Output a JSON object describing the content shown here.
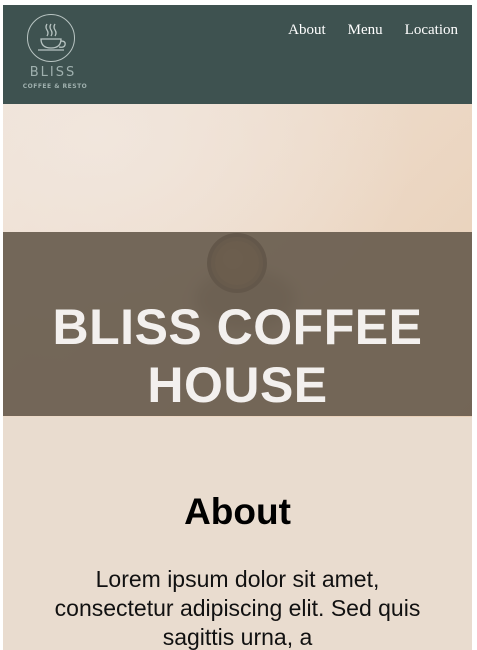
{
  "header": {
    "logo": {
      "name": "BLISS",
      "tagline": "COFFEE & RESTO"
    },
    "nav": [
      {
        "label": "About"
      },
      {
        "label": "Menu"
      },
      {
        "label": "Location"
      }
    ]
  },
  "hero": {
    "title": "BLISS COFFEE HOUSE"
  },
  "about": {
    "heading": "About",
    "text": "Lorem ipsum dolor sit amet, consectetur adipiscing elit. Sed quis sagittis urna, a"
  },
  "colors": {
    "header_bg": "#3e5250",
    "hero_band": "#685c4e",
    "page_bg": "#e9dccf"
  }
}
